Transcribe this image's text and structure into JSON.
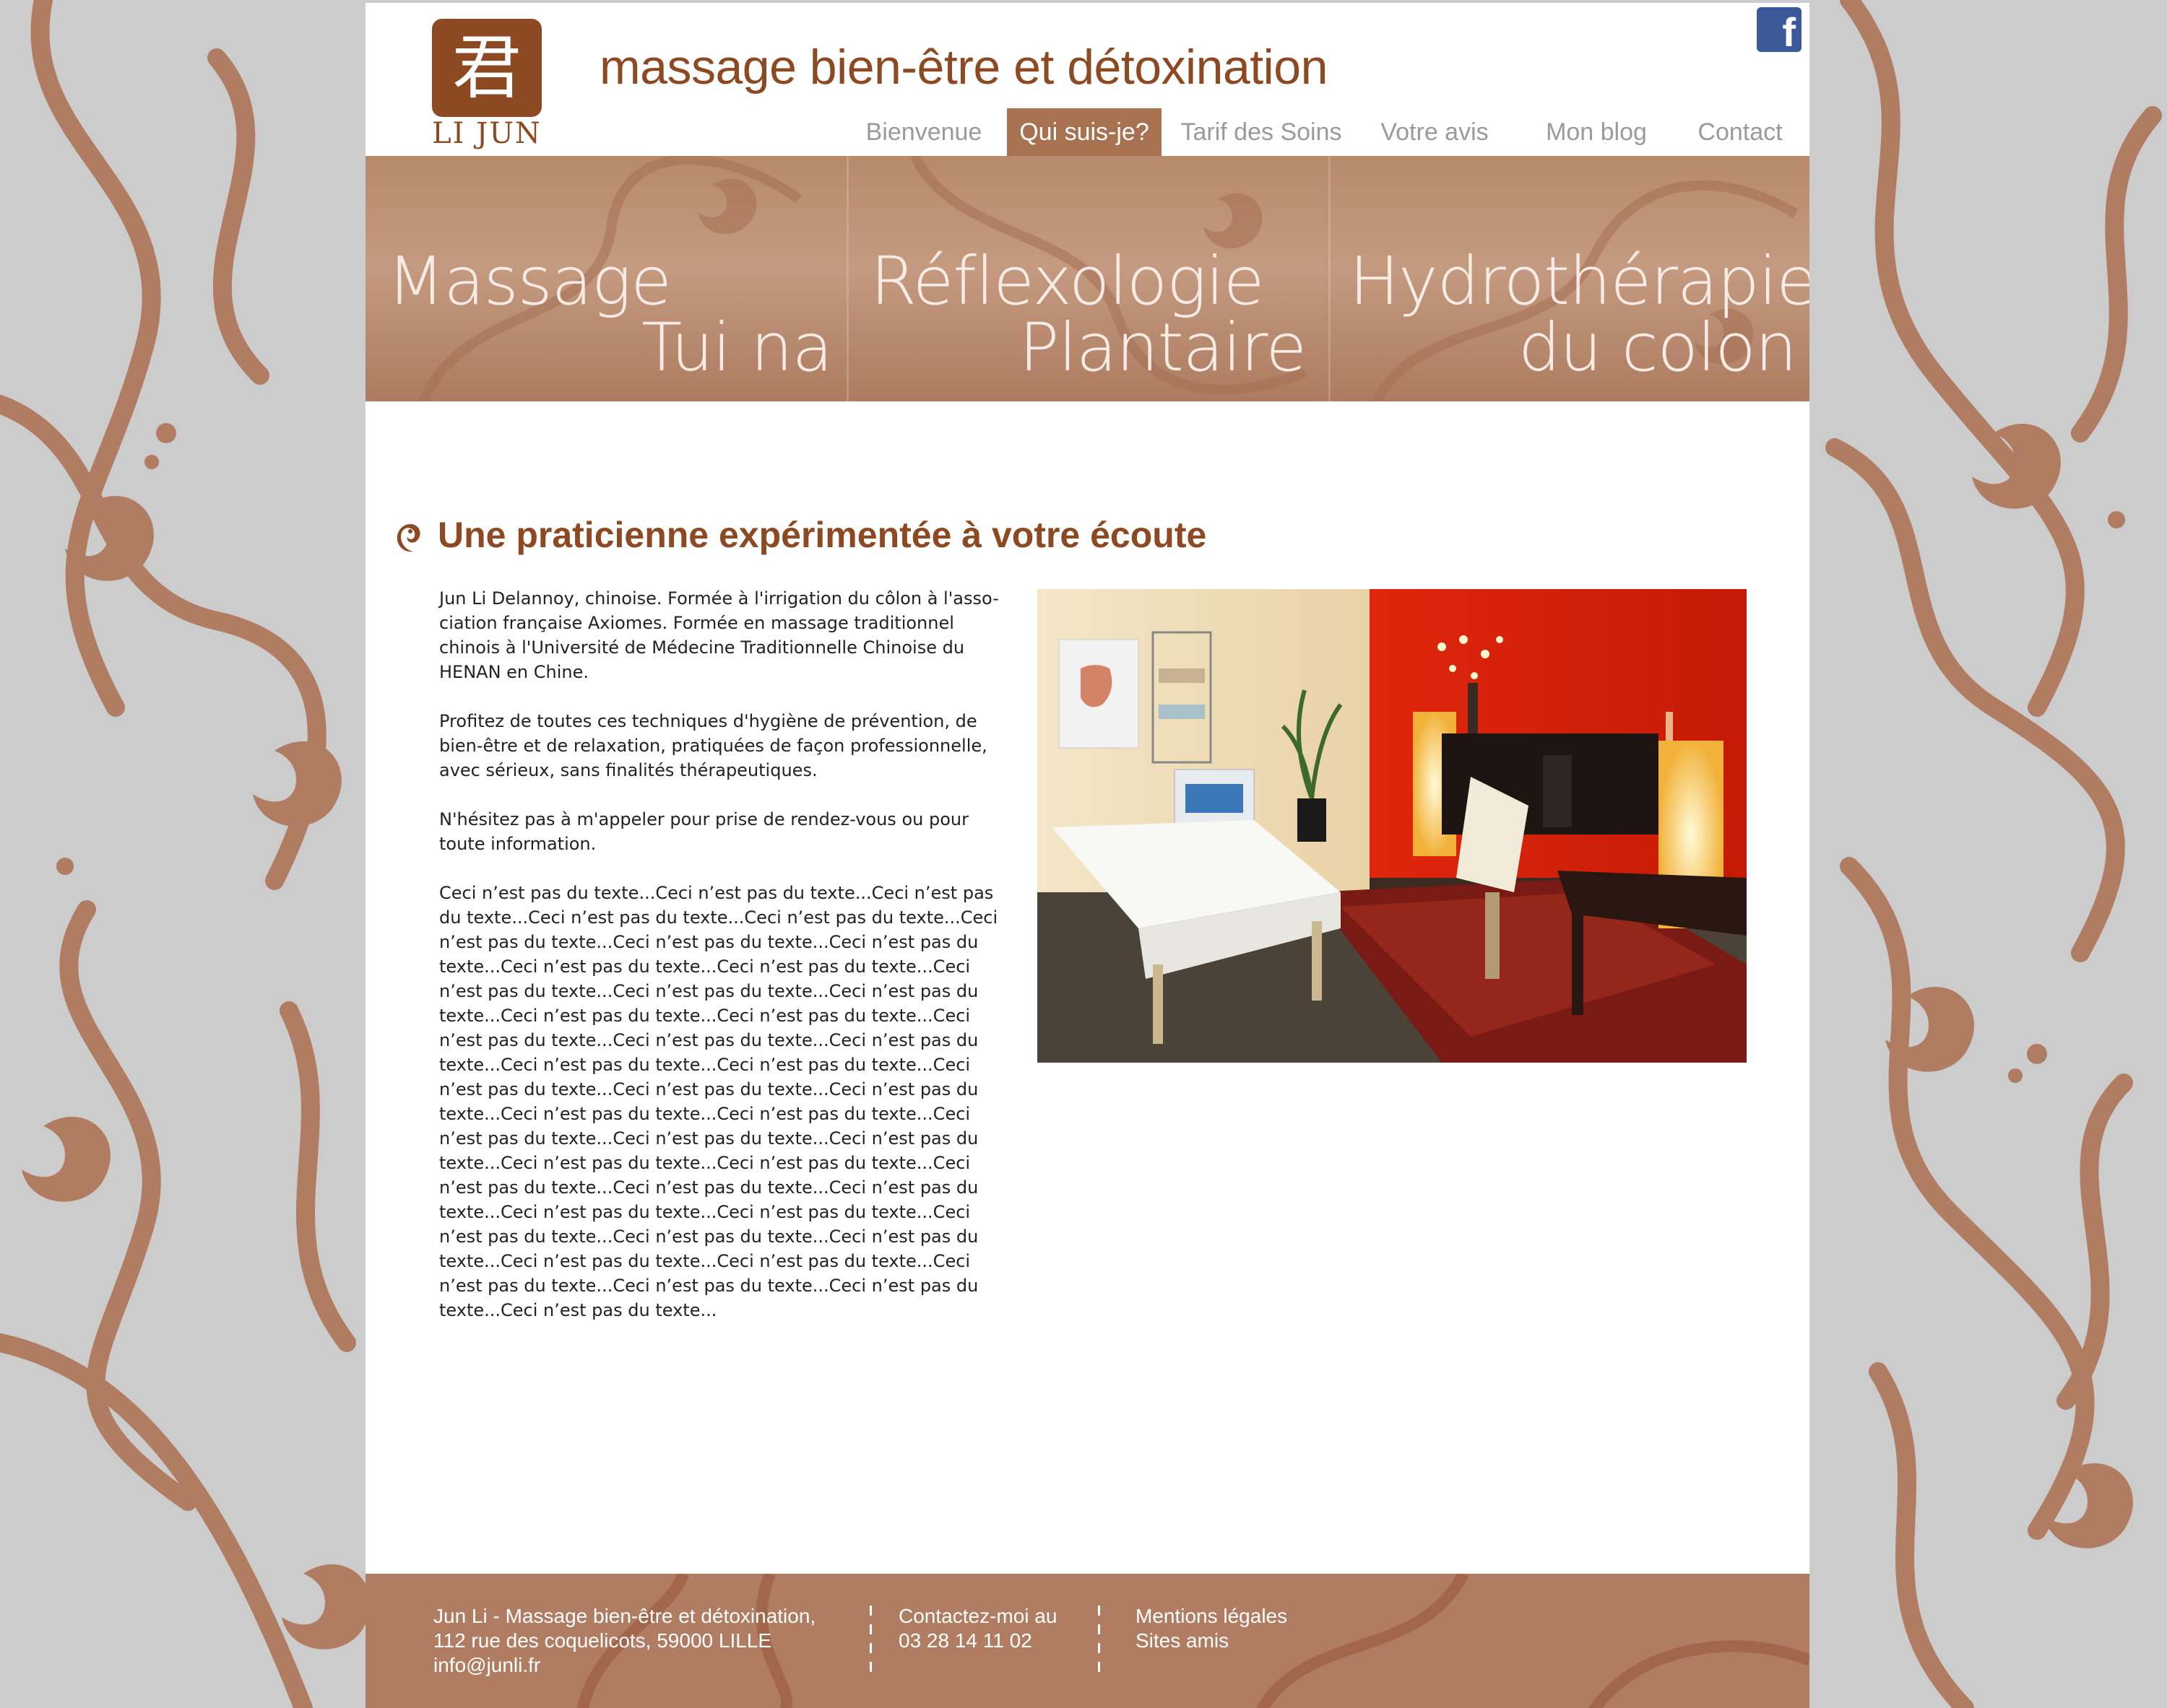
{
  "header": {
    "logo_text": "LI JUN",
    "logo_glyph": "君",
    "title": "massage bien-être et détoxination",
    "facebook_icon": "f"
  },
  "nav": {
    "items": [
      {
        "label": "Bienvenue",
        "active": false
      },
      {
        "label": "Qui suis-je?",
        "active": true
      },
      {
        "label": "Tarif des Soins",
        "active": false
      },
      {
        "label": "Votre avis",
        "active": false
      },
      {
        "label": "Mon blog",
        "active": false
      },
      {
        "label": "Contact",
        "active": false
      }
    ]
  },
  "banner": {
    "panels": [
      {
        "line1": "Massage",
        "line2": "Tui na"
      },
      {
        "line1": "Réflexologie",
        "line2": "Plantaire"
      },
      {
        "line1": "Hydrothérapie",
        "line2": "du colon"
      }
    ]
  },
  "main": {
    "title": "Une praticienne expérimentée à votre écoute",
    "paragraphs": [
      "Jun Li Delannoy, chinoise. Formée à l'irrigation du côlon à l'asso-ciation française Axiomes. Formée en massage traditionnel chinois à l'Université de Médecine Traditionnelle Chinoise du HENAN en Chine.",
      "Profitez de toutes ces techniques d'hygiène de prévention, de bien-être et de relaxation, pratiquées de façon professionnelle, avec sérieux, sans finalités thérapeutiques.",
      "N'hésitez pas à m'appeler pour prise de rendez-vous ou pour toute information.",
      "Ceci n’est pas du texte...Ceci n’est pas du texte...Ceci n’est pas du texte...Ceci n’est pas du texte...Ceci n’est pas du texte...Ceci n’est pas du texte...Ceci n’est pas du texte...Ceci n’est pas du texte...Ceci n’est pas du texte...Ceci n’est pas du texte...Ceci n’est pas du texte...Ceci n’est pas du texte...Ceci n’est pas du texte...Ceci n’est pas du texte...Ceci n’est pas du texte...Ceci n’est pas du texte...Ceci n’est pas du texte...Ceci n’est pas du texte...Ceci n’est pas du texte...Ceci n’est pas du texte...Ceci n’est pas du texte...Ceci n’est pas du texte...Ceci n’est pas du texte...Ceci n’est pas du texte...Ceci n’est pas du texte...Ceci n’est pas du texte...Ceci n’est pas du texte...Ceci n’est pas du texte...Ceci n’est pas du texte...Ceci n’est pas du texte...Ceci n’est pas du texte...Ceci n’est pas du texte...Ceci n’est pas du texte...Ceci n’est pas du texte...Ceci n’est pas du texte...Ceci n’est pas du texte...Ceci n’est pas du texte...Ceci n’est pas du texte...Ceci n’est pas du texte...Ceci n’est pas du texte...Ceci n’est pas du texte...Ceci n’est pas du texte...Ceci n’est pas du texte...Ceci n’est pas du texte..."
    ]
  },
  "footer": {
    "address_line1": "Jun Li - Massage bien-être et détoxination,",
    "address_line2": "112 rue des coquelicots, 59000 LILLE",
    "email": "info@junli.fr",
    "contact_label": "Contactez-moi au",
    "phone": "03 28 14 11 02",
    "legal_link": "Mentions légales",
    "friends_link": "Sites amis"
  },
  "colors": {
    "brand": "#8d4a22",
    "nav_active_bg": "#a8714f",
    "footer_bg": "#b07c62",
    "page_bg": "#cccccc"
  }
}
